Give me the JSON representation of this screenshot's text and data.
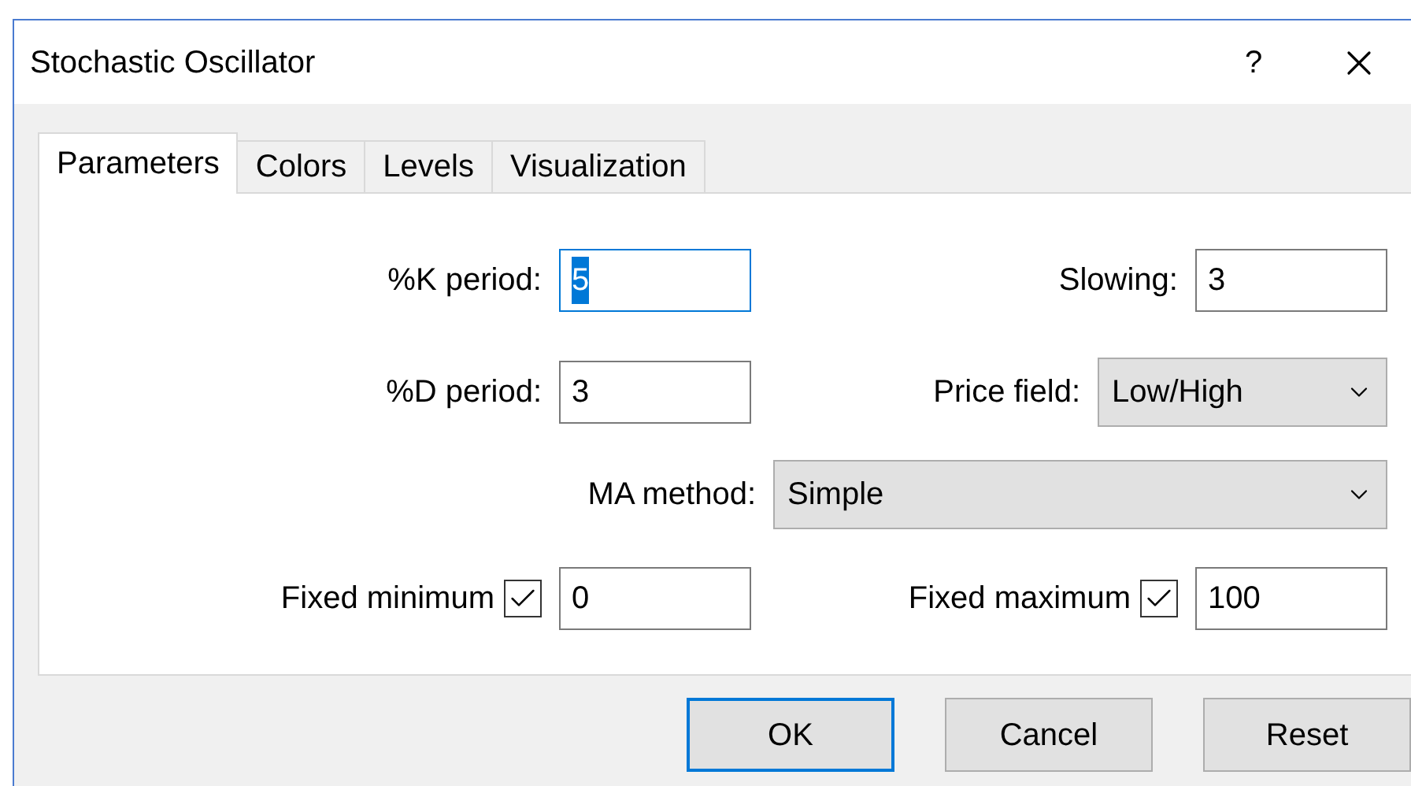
{
  "window": {
    "title": "Stochastic Oscillator",
    "help": "?"
  },
  "tabs": [
    {
      "label": "Parameters",
      "selected": true
    },
    {
      "label": "Colors",
      "selected": false
    },
    {
      "label": "Levels",
      "selected": false
    },
    {
      "label": "Visualization",
      "selected": false
    }
  ],
  "rows": [
    {
      "left": {
        "kind": "text",
        "label": "%K period:",
        "value": "5",
        "focused": true
      },
      "right": {
        "kind": "text",
        "label": "Slowing:",
        "value": "3",
        "focused": false
      }
    },
    {
      "left": {
        "kind": "text",
        "label": "%D period:",
        "value": "3",
        "focused": false
      },
      "right": {
        "kind": "select",
        "label": "Price field:",
        "value": "Low/High"
      }
    },
    {
      "wide": {
        "kind": "select",
        "label": "MA method:",
        "value": "Simple"
      }
    },
    {
      "left": {
        "kind": "check",
        "label": "Fixed minimum",
        "checked": true,
        "value": "0",
        "focused": false
      },
      "right": {
        "kind": "check",
        "label": "Fixed maximum",
        "checked": true,
        "value": "100",
        "focused": false
      }
    }
  ],
  "buttons": [
    {
      "label": "OK",
      "default": true
    },
    {
      "label": "Cancel",
      "default": false
    },
    {
      "label": "Reset",
      "default": false
    }
  ]
}
